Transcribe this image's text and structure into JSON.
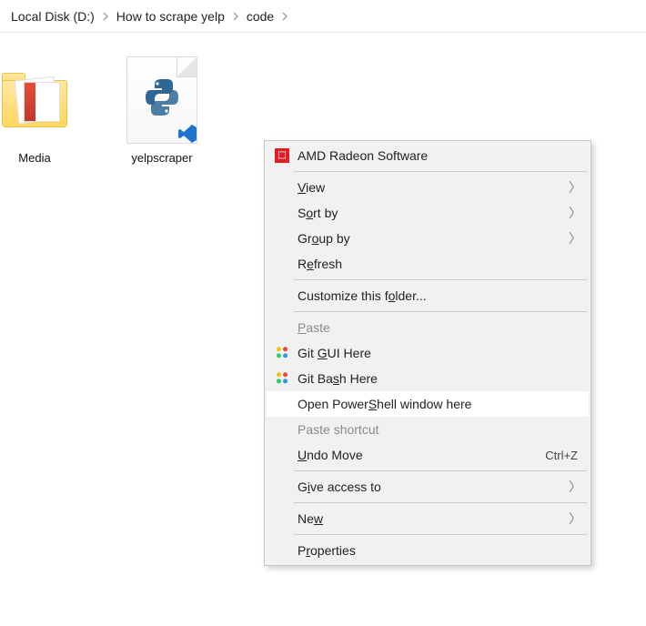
{
  "breadcrumb": {
    "items": [
      "Local Disk (D:)",
      "How to scrape yelp",
      "code"
    ]
  },
  "files": {
    "media": {
      "label": "Media"
    },
    "yelp": {
      "label": "yelpscraper"
    }
  },
  "menu": {
    "amd": {
      "label": "AMD Radeon Software"
    },
    "view": {
      "pre": "",
      "u": "V",
      "post": "iew"
    },
    "sort": {
      "pre": "S",
      "u": "o",
      "post": "rt by"
    },
    "group": {
      "pre": "Gr",
      "u": "o",
      "post": "up by"
    },
    "refresh": {
      "pre": "R",
      "u": "e",
      "post": "fresh"
    },
    "customize": {
      "pre": "Customize this f",
      "u": "o",
      "post": "lder..."
    },
    "paste": {
      "pre": "",
      "u": "P",
      "post": "aste"
    },
    "gitgui": {
      "pre": "Git ",
      "u": "G",
      "post": "UI Here"
    },
    "gitbash": {
      "pre": "Git Ba",
      "u": "s",
      "post": "h Here"
    },
    "powershell": {
      "pre": "Open Power",
      "u": "S",
      "post": "hell window here"
    },
    "pastesc": {
      "label": "Paste shortcut"
    },
    "undo": {
      "pre": "",
      "u": "U",
      "post": "ndo Move",
      "shortcut": "Ctrl+Z"
    },
    "access": {
      "pre": "G",
      "u": "i",
      "post": "ve access to"
    },
    "new": {
      "pre": "Ne",
      "u": "w",
      "post": ""
    },
    "props": {
      "pre": "P",
      "u": "r",
      "post": "operties"
    }
  }
}
